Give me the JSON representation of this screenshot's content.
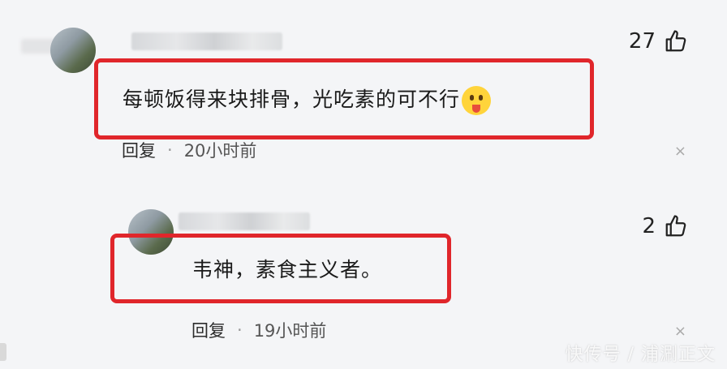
{
  "comments": [
    {
      "text": "每顿饭得来块排骨，光吃素的可不行",
      "emoji": "tongue-out-emoji",
      "likes": "27",
      "reply_label": "回复",
      "separator": "·",
      "time": "20小时前",
      "close": "×"
    },
    {
      "text": "韦神，素食主义者。",
      "likes": "2",
      "reply_label": "回复",
      "separator": "·",
      "time": "19小时前",
      "close": "×"
    }
  ],
  "watermark": "快传号 / 浦涮正文",
  "colors": {
    "highlight_border": "#e0262b",
    "background": "#f4f5f7"
  },
  "icons": {
    "like": "thumbs-up-icon",
    "close": "close-icon"
  }
}
